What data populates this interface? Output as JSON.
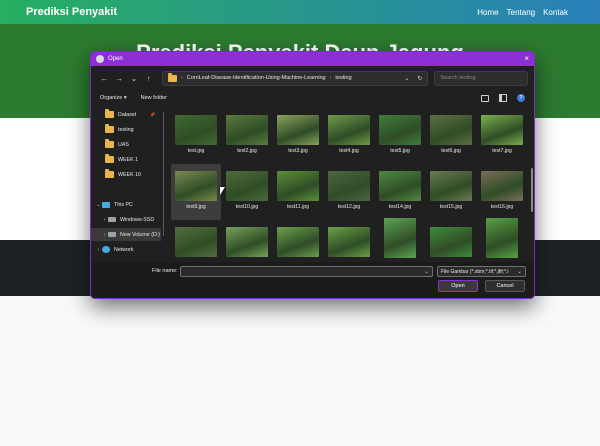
{
  "webpage": {
    "brand": "Prediksi Penyakit",
    "nav": [
      "Home",
      "Tentang",
      "Kontak"
    ],
    "hero_title": "Prediksi Penyakit Daun Jagung"
  },
  "dialog": {
    "title": "Open",
    "close_label": "×",
    "path": [
      "CornLeaf-Disease-Identification-Using-Machine-Learning",
      "testing"
    ],
    "search_placeholder": "Search testing",
    "toolbar": {
      "organize": "Organize ▾",
      "new_folder": "New folder"
    },
    "nav_items": [
      {
        "label": "Dataset",
        "kind": "folder",
        "pinned": true
      },
      {
        "label": "testing",
        "kind": "folder"
      },
      {
        "label": "UAS",
        "kind": "folder"
      },
      {
        "label": "WEEK 1",
        "kind": "folder"
      },
      {
        "label": "WEEK 10",
        "kind": "folder"
      },
      {
        "label": "This PC",
        "kind": "pc"
      },
      {
        "label": "Windows-SSD",
        "kind": "drive"
      },
      {
        "label": "New Volume (D:)",
        "kind": "drive",
        "selected": true
      },
      {
        "label": "Network",
        "kind": "network"
      }
    ],
    "files": [
      {
        "name": "test.jpg",
        "color": "#3f6a31"
      },
      {
        "name": "test2.jpg",
        "color": "#5b7a3e"
      },
      {
        "name": "test3.jpg",
        "color": "#8aa25e"
      },
      {
        "name": "test4.jpg",
        "color": "#6f9a4b"
      },
      {
        "name": "test5.jpg",
        "color": "#3e7d3b"
      },
      {
        "name": "test6.jpg",
        "color": "#5d6e44"
      },
      {
        "name": "test7.jpg",
        "color": "#7ab04d"
      },
      {
        "name": "test9.jpg",
        "color": "#7a8a4f",
        "selected": true
      },
      {
        "name": "test10.jpg",
        "color": "#4f6b3b"
      },
      {
        "name": "test11.jpg",
        "color": "#5c8f3a"
      },
      {
        "name": "test12.jpg",
        "color": "#4b6640"
      },
      {
        "name": "test14.jpg",
        "color": "#4f8a43"
      },
      {
        "name": "test15.jpg",
        "color": "#6a7a52"
      },
      {
        "name": "test16.jpg",
        "color": "#7a6e58"
      },
      {
        "name": "",
        "color": "#546e3e"
      },
      {
        "name": "",
        "color": "#78a25a"
      },
      {
        "name": "",
        "color": "#6b9e4e"
      },
      {
        "name": "",
        "color": "#6aa048"
      },
      {
        "name": "",
        "color": "#5da355"
      },
      {
        "name": "",
        "color": "#3f8c3a"
      },
      {
        "name": "",
        "color": "#5aa044"
      }
    ],
    "file_name_label": "File name:",
    "file_name_value": "",
    "filter_label": "File Gambar (*.xbm;*.tif;*.jfif;*.i",
    "open_button": "Open",
    "cancel_button": "Cancel"
  },
  "icons": {
    "back": "arrow-left-icon",
    "forward": "arrow-right-icon",
    "recent": "chevron-down-icon",
    "up": "arrow-up-icon",
    "refresh": "refresh-icon",
    "help": "help-icon"
  }
}
